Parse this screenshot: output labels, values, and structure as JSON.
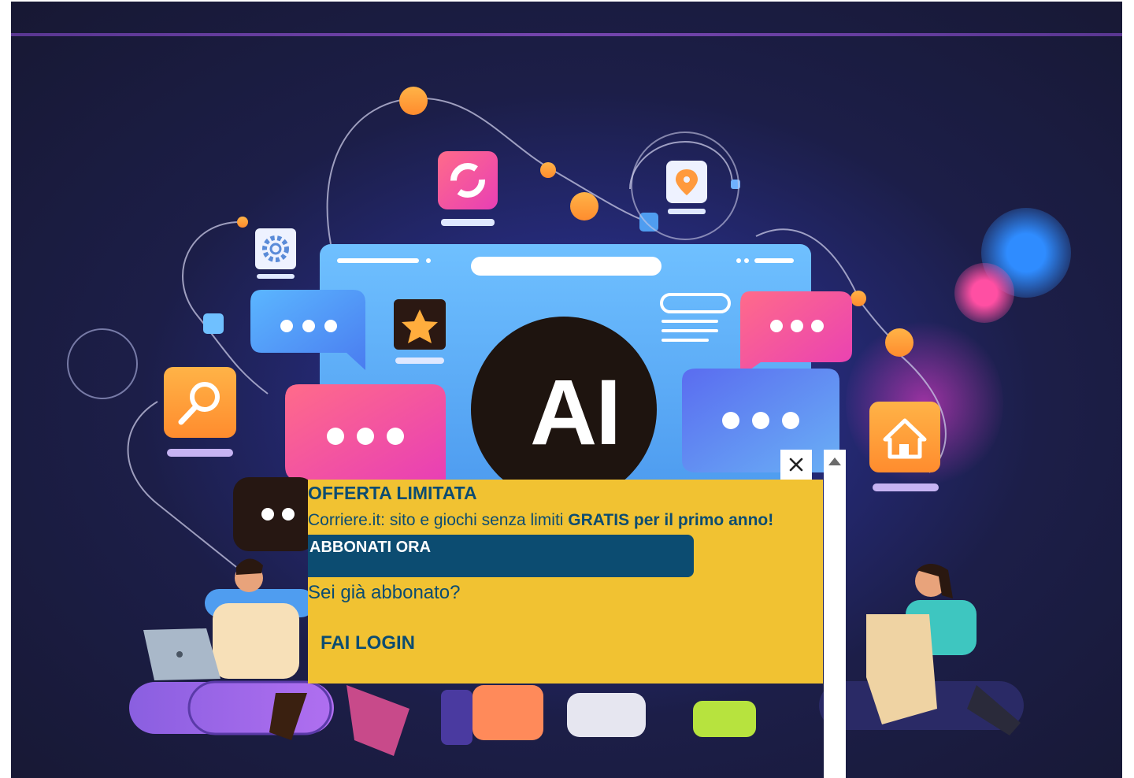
{
  "hero": {
    "ai_text": "AI"
  },
  "popup": {
    "title": "OFFERTA LIMITATA",
    "text_prefix": "Corriere.it: sito e giochi senza limiti",
    "text_highlight": "GRATIS per il primo anno!",
    "subscribe_label": "ABBONATI ORA",
    "already_subscribed": "Sei già abbonato?",
    "login_label": "FAI LOGIN"
  },
  "colors": {
    "popup_background": "#f1c232",
    "popup_text": "#0c4c71",
    "button_background": "#0c4c71",
    "page_background": "#1c1e48"
  },
  "icons": [
    "close-icon",
    "scroll-up-icon",
    "gear-icon",
    "search-icon",
    "star-icon",
    "location-pin-icon",
    "refresh-icon",
    "home-icon",
    "chat-bubble-icon",
    "laptop-icon"
  ]
}
